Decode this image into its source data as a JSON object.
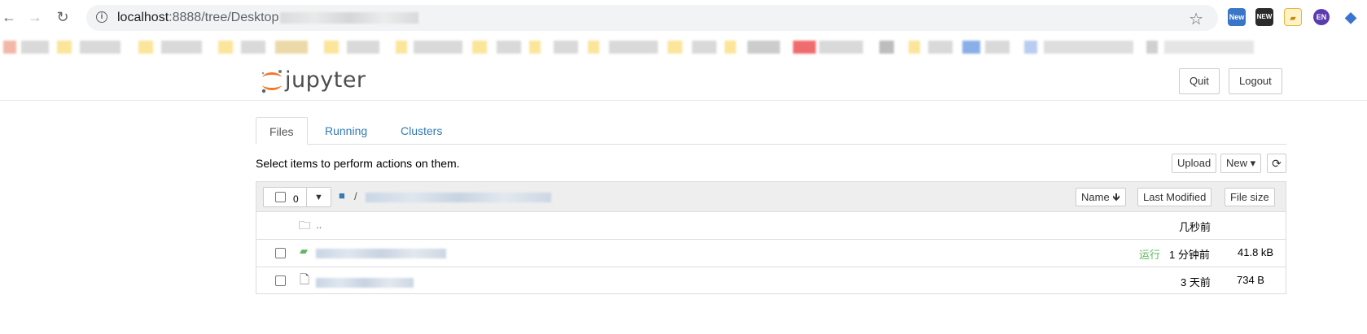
{
  "browser": {
    "url_host": "localhost",
    "url_path": ":8888/tree/Desktop",
    "extensions": [
      {
        "name": "new-extension-icon",
        "label": "New",
        "color": "#3a76c7"
      },
      {
        "name": "new-badge-extension-icon",
        "label": "NEW",
        "color": "#2b2b2b"
      },
      {
        "name": "note-extension-icon",
        "label": "",
        "color": "#e7b43a"
      },
      {
        "name": "profile-avatar-icon",
        "label": "EN",
        "color": "#5b3bb0"
      },
      {
        "name": "graduation-cap-icon",
        "label": "",
        "color": "#3b74d0"
      }
    ]
  },
  "header": {
    "logo_text": "jupyter",
    "quit_label": "Quit",
    "logout_label": "Logout"
  },
  "tabs": [
    {
      "label": "Files",
      "active": true
    },
    {
      "label": "Running",
      "active": false
    },
    {
      "label": "Clusters",
      "active": false
    }
  ],
  "toolbar": {
    "hint": "Select items to perform actions on them.",
    "upload_label": "Upload",
    "new_label": "New ▾",
    "refresh_icon": "refresh-icon"
  },
  "list_header": {
    "selected_count": "0",
    "breadcrumb_sep": "/",
    "sort_name": "Name",
    "sort_modified": "Last Modified",
    "sort_size": "File size"
  },
  "rows": [
    {
      "type": "parent-folder",
      "name": "..",
      "status": "",
      "modified": "几秒前",
      "size": ""
    },
    {
      "type": "notebook",
      "name": "",
      "status": "运行",
      "modified": "1 分钟前",
      "size": "41.8 kB"
    },
    {
      "type": "file",
      "name": "",
      "status": "",
      "modified": "3 天前",
      "size": "734 B"
    }
  ]
}
